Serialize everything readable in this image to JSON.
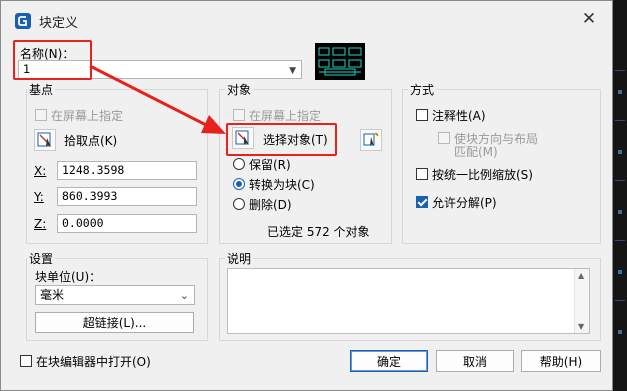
{
  "title": "块定义",
  "name": {
    "label": "名称(N)：",
    "value": "1"
  },
  "basepoint": {
    "group_title": "基点",
    "on_screen_label": "在屏幕上指定",
    "pick_label": "拾取点(K)",
    "x_label": "X:",
    "x_value": "1248.3598",
    "y_label": "Y:",
    "y_value": "860.3993",
    "z_label": "Z:",
    "z_value": "0.0000"
  },
  "objects": {
    "group_title": "对象",
    "on_screen_label": "在屏幕上指定",
    "select_label": "选择对象(T)",
    "retain_label": "保留(R)",
    "convert_label": "转换为块(C)",
    "delete_label": "删除(D)",
    "selected_count_text": "已选定 572 个对象"
  },
  "behavior": {
    "group_title": "方式",
    "annotative_label": "注释性(A)",
    "match_orient_label_line1": "使块方向与布局",
    "match_orient_label_line2": "匹配(M)",
    "scale_uniform_label": "按统一比例缩放(S)",
    "allow_explode_label": "允许分解(P)"
  },
  "settings": {
    "group_title": "设置",
    "unit_label": "块单位(U)：",
    "unit_value": "毫米",
    "hyperlink_label": "超链接(L)..."
  },
  "description": {
    "group_title": "说明",
    "value": ""
  },
  "footer": {
    "open_in_editor_label": "在块编辑器中打开(O)",
    "ok_label": "确定",
    "cancel_label": "取消",
    "help_label": "帮助(H)"
  },
  "colors": {
    "accent": "#1a5fb4",
    "highlight": "#e8211b"
  }
}
